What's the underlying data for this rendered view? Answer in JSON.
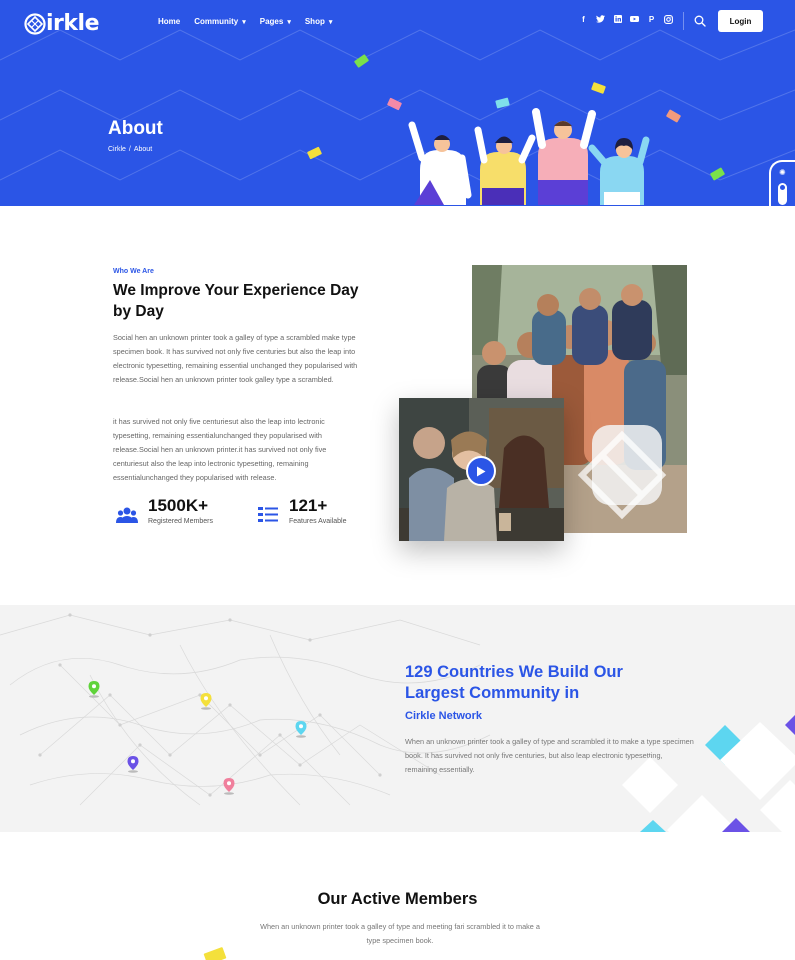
{
  "brand": {
    "name": "irkle"
  },
  "nav": {
    "items": [
      {
        "label": "Home",
        "caret": false
      },
      {
        "label": "Community",
        "caret": true
      },
      {
        "label": "Pages",
        "caret": true
      },
      {
        "label": "Shop",
        "caret": true
      }
    ],
    "socials": [
      {
        "icon": "facebook-icon",
        "glyph": "f"
      },
      {
        "icon": "twitter-icon",
        "glyph": "t"
      },
      {
        "icon": "linkedin-icon",
        "glyph": "in"
      },
      {
        "icon": "youtube-icon",
        "glyph": "▶"
      },
      {
        "icon": "pinterest-icon",
        "glyph": "P"
      },
      {
        "icon": "instagram-icon",
        "glyph": "◎"
      }
    ],
    "login_label": "Login"
  },
  "hero": {
    "title": "About",
    "breadcrumb": {
      "home": "Cirkle",
      "separator": "/",
      "current": "About"
    }
  },
  "about": {
    "eyebrow": "Who We Are",
    "title": "We Improve Your Experience Day by Day",
    "paragraph1": "Social hen an unknown printer took a galley of type a scrambled make type specimen book. It has survived not only five centuries but also the leap into electronic typesetting, remaining essential unchanged they popularised with release.Social hen an unknown printer took galley type a scrambled.",
    "paragraph2": "it has survived not only five centuriesut also the leap into lectronic typesetting, remaining essentialunchanged they popularised with release.Social hen an unknown printer.it has survived not only five centuriesut also the leap into lectronic typesetting, remaining essentialunchanged they popularised with release.",
    "stats": [
      {
        "value": "1500K+",
        "label": "Registered Members",
        "icon": "members-icon"
      },
      {
        "value": "121+",
        "label": "Features Available",
        "icon": "features-list-icon"
      }
    ]
  },
  "map_section": {
    "title": "129 Countries We Build Our Largest Community in",
    "subtitle": "Cirkle Network",
    "text": "When an unknown printer took a galley of type and scrambled it to make a type specimen book. It has survived not only five centuries, but also leap electronic typesetting, remaining essentially."
  },
  "members": {
    "title": "Our Active Members",
    "text": "When an unknown printer took a galley of type and meeting fari scrambled it to make a type specimen book."
  },
  "colors": {
    "primary": "#2b55e6",
    "pin_green": "#5fd33a",
    "pin_yellow": "#f4e03b",
    "pin_cyan": "#5dd6f0",
    "pin_purple": "#6b52e6",
    "pin_pink": "#f07f9c"
  }
}
